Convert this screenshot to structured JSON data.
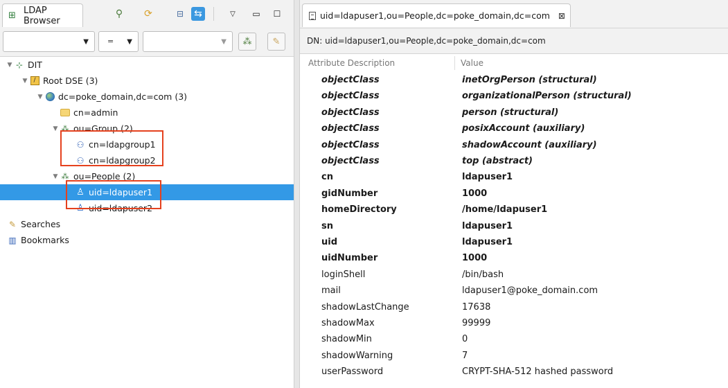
{
  "left_panel": {
    "tab_title": "LDAP Browser",
    "filter": {
      "operator": "="
    },
    "tree": [
      {
        "label": "DIT",
        "icon": "dit-icon"
      },
      {
        "label": "Root DSE (3)",
        "icon": "root-dse-icon"
      },
      {
        "label": "dc=poke_domain,dc=com (3)",
        "icon": "globe-icon"
      },
      {
        "label": "cn=admin",
        "icon": "folder-icon"
      },
      {
        "label": "ou=Group (2)",
        "icon": "ou-icon"
      },
      {
        "label": "cn=ldapgroup1",
        "icon": "group-icon"
      },
      {
        "label": "cn=ldapgroup2",
        "icon": "group-icon"
      },
      {
        "label": "ou=People (2)",
        "icon": "ou-icon"
      },
      {
        "label": "uid=ldapuser1",
        "icon": "user-icon",
        "selected": true
      },
      {
        "label": "uid=ldapuser2",
        "icon": "user-icon"
      },
      {
        "label": "Searches",
        "icon": "searches-icon"
      },
      {
        "label": "Bookmarks",
        "icon": "bookmarks-icon"
      }
    ]
  },
  "editor": {
    "tab_title": "uid=ldapuser1,ou=People,dc=poke_domain,dc=com",
    "dn_label": "DN: uid=ldapuser1,ou=People,dc=poke_domain,dc=com",
    "columns": {
      "attribute": "Attribute Description",
      "value": "Value"
    },
    "rows": [
      {
        "attr": "objectClass",
        "value": "inetOrgPerson (structural)",
        "style": "objectclass"
      },
      {
        "attr": "objectClass",
        "value": "organizationalPerson (structural)",
        "style": "objectclass"
      },
      {
        "attr": "objectClass",
        "value": "person (structural)",
        "style": "objectclass"
      },
      {
        "attr": "objectClass",
        "value": "posixAccount (auxiliary)",
        "style": "objectclass"
      },
      {
        "attr": "objectClass",
        "value": "shadowAccount (auxiliary)",
        "style": "objectclass"
      },
      {
        "attr": "objectClass",
        "value": "top (abstract)",
        "style": "objectclass"
      },
      {
        "attr": "cn",
        "value": "ldapuser1",
        "style": "must"
      },
      {
        "attr": "gidNumber",
        "value": "1000",
        "style": "must"
      },
      {
        "attr": "homeDirectory",
        "value": "/home/ldapuser1",
        "style": "must"
      },
      {
        "attr": "sn",
        "value": "ldapuser1",
        "style": "must"
      },
      {
        "attr": "uid",
        "value": "ldapuser1",
        "style": "must"
      },
      {
        "attr": "uidNumber",
        "value": "1000",
        "style": "must"
      },
      {
        "attr": "loginShell",
        "value": "/bin/bash",
        "style": "may"
      },
      {
        "attr": "mail",
        "value": "ldapuser1@poke_domain.com",
        "style": "may"
      },
      {
        "attr": "shadowLastChange",
        "value": "17638",
        "style": "may"
      },
      {
        "attr": "shadowMax",
        "value": "99999",
        "style": "may"
      },
      {
        "attr": "shadowMin",
        "value": "0",
        "style": "may"
      },
      {
        "attr": "shadowWarning",
        "value": "7",
        "style": "may"
      },
      {
        "attr": "userPassword",
        "value": "CRYPT-SHA-512 hashed password",
        "style": "may"
      }
    ]
  },
  "colors": {
    "selection": "#3399e6",
    "highlight_box": "#e5411e",
    "active_toolbar_button": "#3b98e0"
  }
}
